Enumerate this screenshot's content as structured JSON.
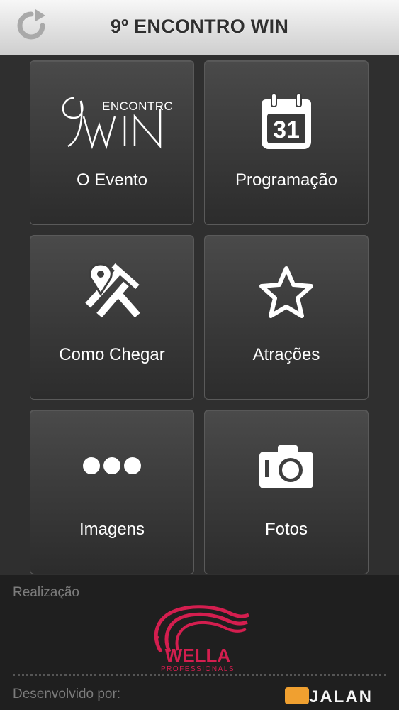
{
  "header": {
    "title": "9º ENCONTRO WIN",
    "refresh_icon": "refresh-icon"
  },
  "tiles": [
    {
      "label": "O Evento",
      "icon": "encontro-win-logo"
    },
    {
      "label": "Programação",
      "icon": "calendar-icon",
      "calendar_day": "31"
    },
    {
      "label": "Como Chegar",
      "icon": "map-directions-icon"
    },
    {
      "label": "Atrações",
      "icon": "star-icon"
    },
    {
      "label": "Imagens",
      "icon": "more-dots-icon"
    },
    {
      "label": "Fotos",
      "icon": "camera-icon"
    }
  ],
  "logo": {
    "small": "ENCONTRO",
    "big": "9WIN"
  },
  "footer": {
    "realizacao_label": "Realização",
    "sponsor_name": "WELLA",
    "sponsor_sub": "PROFESSIONALS",
    "developer_label": "Desenvolvido por:",
    "developer_name": "JALAN"
  },
  "colors": {
    "header_bg": "#e6e6e6",
    "tile_bg": "#3e3e3e",
    "wella_pink": "#d41e4f",
    "jalan_orange": "#f0a030",
    "footer_bg": "#1f1f1f"
  }
}
